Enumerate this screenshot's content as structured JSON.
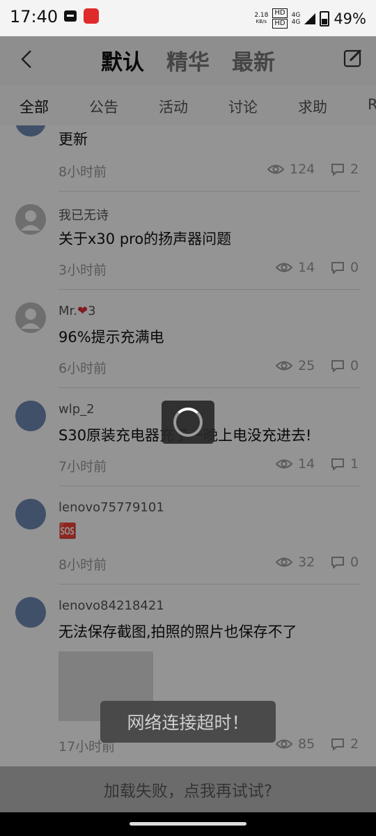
{
  "status_bar": {
    "time": "17:40",
    "net_speed_value": "2.18",
    "net_speed_unit": "KB/s",
    "hd_badge_1": "HD",
    "hd_badge_2": "HD",
    "signal_1": "4G",
    "signal_2": "4G",
    "battery": "49%"
  },
  "header": {
    "tabs": [
      {
        "label": "默认",
        "active": true
      },
      {
        "label": "精华",
        "active": false
      },
      {
        "label": "最新",
        "active": false
      }
    ]
  },
  "categories": [
    {
      "label": "全部",
      "active": true
    },
    {
      "label": "公告",
      "active": false
    },
    {
      "label": "活动",
      "active": false
    },
    {
      "label": "讨论",
      "active": false
    },
    {
      "label": "求助",
      "active": false
    },
    {
      "label": "R",
      "active": false
    }
  ],
  "posts": [
    {
      "username": "",
      "title": "更新",
      "time": "8小时前",
      "views": "124",
      "comments": "2"
    },
    {
      "username": "我已无诗",
      "title": "关于x30 pro的扬声器问题",
      "time": "3小时前",
      "views": "14",
      "comments": "0"
    },
    {
      "username": "Mr.",
      "username_heart": "❤",
      "username_suffix": "3",
      "title": "96%提示充满电",
      "time": "6小时前",
      "views": "25",
      "comments": "0"
    },
    {
      "username": "wlp_2",
      "title": "S30原装充电器充了一晚上电没充进去!",
      "time": "7小时前",
      "views": "14",
      "comments": "1"
    },
    {
      "username": "lenovo75779101",
      "title": "🆘",
      "time": "8小时前",
      "views": "32",
      "comments": "0"
    },
    {
      "username": "lenovo84218421",
      "title": "无法保存截图,拍照的照片也保存不了",
      "time": "17小时前",
      "views": "85",
      "comments": "2"
    }
  ],
  "toast": "网络连接超时！",
  "retry": "加载失败，点我再试试?"
}
